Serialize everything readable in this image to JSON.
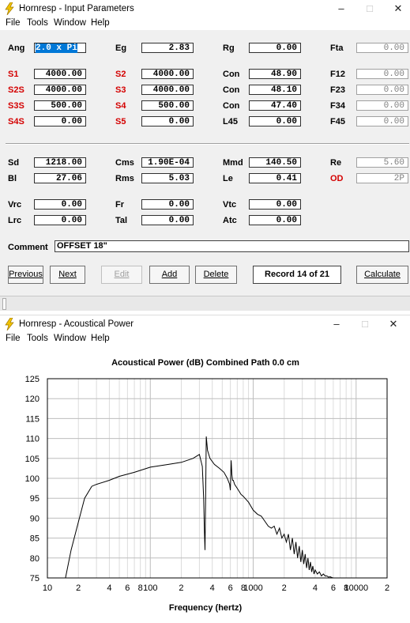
{
  "window1": {
    "title": "Hornresp - Input Parameters",
    "controls": {
      "minimize": "–",
      "maximize": "□",
      "close": "✕"
    },
    "menu": [
      "File",
      "Tools",
      "Window",
      "Help"
    ],
    "rows": [
      [
        {
          "label": "Ang",
          "value": "2.0 x Pi",
          "selected": true
        },
        {
          "label": "Eg",
          "value": "2.83"
        },
        {
          "label": "Rg",
          "value": "0.00"
        },
        {
          "label": "Fta",
          "value": "0.00",
          "disabled": true
        }
      ],
      [
        {
          "label": "S1",
          "value": "4000.00",
          "red": true
        },
        {
          "label": "S2",
          "value": "4000.00",
          "red": true
        },
        {
          "label": "Con",
          "value": "48.90"
        },
        {
          "label": "F12",
          "value": "0.00",
          "disabled": true
        }
      ],
      [
        {
          "label": "S2S",
          "value": "4000.00",
          "red": true
        },
        {
          "label": "S3",
          "value": "4000.00",
          "red": true
        },
        {
          "label": "Con",
          "value": "48.10"
        },
        {
          "label": "F23",
          "value": "0.00",
          "disabled": true
        }
      ],
      [
        {
          "label": "S3S",
          "value": "500.00",
          "red": true
        },
        {
          "label": "S4",
          "value": "500.00",
          "red": true
        },
        {
          "label": "Con",
          "value": "47.40"
        },
        {
          "label": "F34",
          "value": "0.00",
          "disabled": true
        }
      ],
      [
        {
          "label": "S4S",
          "value": "0.00",
          "red": true
        },
        {
          "label": "S5",
          "value": "0.00",
          "red": true
        },
        {
          "label": "L45",
          "value": "0.00"
        },
        {
          "label": "F45",
          "value": "0.00",
          "disabled": true
        }
      ],
      [
        {
          "label": "Sd",
          "value": "1218.00"
        },
        {
          "label": "Cms",
          "value": "1.90E-04"
        },
        {
          "label": "Mmd",
          "value": "140.50"
        },
        {
          "label": "Re",
          "value": "5.60",
          "disabled": true
        }
      ],
      [
        {
          "label": "Bl",
          "value": "27.06"
        },
        {
          "label": "Rms",
          "value": "5.03"
        },
        {
          "label": "Le",
          "value": "0.41"
        },
        {
          "label": "OD",
          "value": "2P",
          "red": true,
          "disabled": true
        }
      ],
      [
        {
          "label": "Vrc",
          "value": "0.00"
        },
        {
          "label": "Fr",
          "value": "0.00"
        },
        {
          "label": "Vtc",
          "value": "0.00"
        }
      ],
      [
        {
          "label": "Lrc",
          "value": "0.00"
        },
        {
          "label": "Tal",
          "value": "0.00"
        },
        {
          "label": "Atc",
          "value": "0.00"
        }
      ]
    ],
    "comment_label": "Comment",
    "comment_value": "OFFSET 18\"",
    "buttons": {
      "previous": "Previous",
      "next": "Next",
      "edit": "Edit",
      "add": "Add",
      "delete": "Delete",
      "calculate": "Calculate"
    },
    "record": "Record 14 of 21"
  },
  "window2": {
    "title": "Hornresp - Acoustical Power",
    "controls": {
      "minimize": "–",
      "maximize": "□",
      "close": "✕"
    },
    "menu": [
      "File",
      "Tools",
      "Window",
      "Help"
    ]
  },
  "icons": {
    "app": "lightning-icon"
  },
  "colors": {
    "red_label": "#d40000",
    "selection": "#0078d7"
  },
  "chart_data": {
    "type": "line",
    "title": "Acoustical Power (dB)   Combined   Path 0.0 cm",
    "xlabel": "Frequency (hertz)",
    "ylabel": "",
    "xscale": "log",
    "xlim": [
      10,
      20000
    ],
    "ylim": [
      75,
      125
    ],
    "yticks": [
      75,
      80,
      85,
      90,
      95,
      100,
      105,
      110,
      115,
      120,
      125
    ],
    "xtick_labels": [
      {
        "x": 10,
        "label": "10"
      },
      {
        "x": 20,
        "label": "2"
      },
      {
        "x": 40,
        "label": "4"
      },
      {
        "x": 60,
        "label": "6"
      },
      {
        "x": 80,
        "label": "8"
      },
      {
        "x": 100,
        "label": "100"
      },
      {
        "x": 200,
        "label": "2"
      },
      {
        "x": 400,
        "label": "4"
      },
      {
        "x": 600,
        "label": "6"
      },
      {
        "x": 800,
        "label": "8"
      },
      {
        "x": 1000,
        "label": "1000"
      },
      {
        "x": 2000,
        "label": "2"
      },
      {
        "x": 4000,
        "label": "4"
      },
      {
        "x": 6000,
        "label": "6"
      },
      {
        "x": 8000,
        "label": "8"
      },
      {
        "x": 10000,
        "label": "10000"
      },
      {
        "x": 20000,
        "label": "2"
      }
    ],
    "grid": true,
    "series": [
      {
        "x": [
          15,
          17,
          20,
          23,
          27,
          30,
          40,
          50,
          70,
          100,
          150,
          200,
          260,
          300,
          320,
          330,
          335,
          340,
          345,
          350,
          360,
          380,
          420,
          470,
          520,
          560,
          590,
          600,
          610,
          620,
          630,
          640,
          660,
          700,
          760,
          800,
          900,
          1000,
          1100,
          1200,
          1400,
          1500,
          1600,
          1700,
          1800,
          1900,
          2000,
          2100,
          2200,
          2300,
          2400,
          2500,
          2600,
          2700,
          2800,
          2900,
          3000,
          3100,
          3200,
          3300,
          3400,
          3500,
          3600,
          3700,
          3800,
          3900,
          4000,
          4200,
          4400,
          4600,
          4800,
          5000,
          5200,
          5400,
          5600,
          5800,
          6000
        ],
        "y": [
          75,
          82,
          89,
          95,
          98,
          98.5,
          99.5,
          100.5,
          101.5,
          102.8,
          103.5,
          104,
          105,
          106,
          103,
          95,
          87,
          82,
          95,
          110.5,
          107,
          105,
          103.5,
          102.5,
          101.5,
          100,
          98.5,
          97,
          104.5,
          101,
          99.5,
          99.5,
          98.5,
          97.5,
          96,
          95.5,
          94,
          92,
          91,
          90.5,
          88,
          87.5,
          88,
          86,
          87.5,
          85,
          86,
          84,
          86,
          82,
          85,
          81,
          84,
          80,
          83,
          79,
          82,
          78.5,
          81,
          77.5,
          80,
          77,
          79,
          76.5,
          78,
          76,
          77,
          76,
          76.5,
          75.5,
          76,
          75.5,
          75.5,
          75.2,
          75.3,
          75.1,
          75
        ]
      }
    ]
  }
}
